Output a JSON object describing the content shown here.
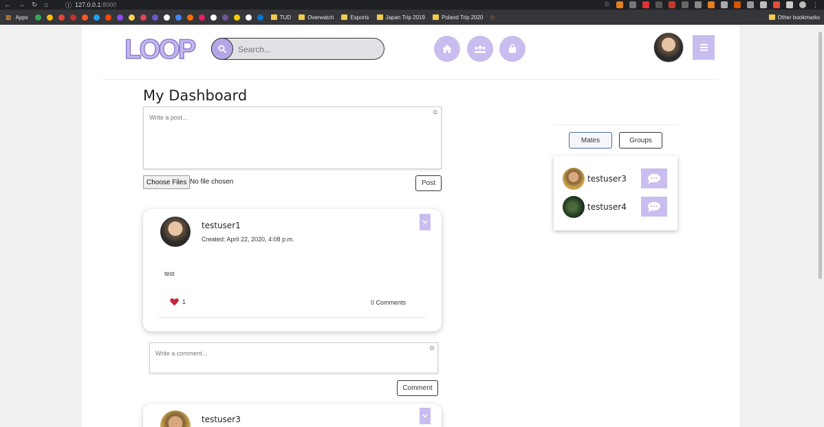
{
  "browser": {
    "url": "127.0.0.1",
    "port": ":8000",
    "bookmarks": {
      "apps": "Apps",
      "folders": [
        "TUD",
        "Overwatch",
        "Esports",
        "Japan Trip 2019",
        "Poland Trip 2020"
      ],
      "other": "Other bookmarks"
    },
    "bookmark_icon_colors": [
      "#34a853",
      "#fbbc04",
      "#ea4335",
      "#c4302b",
      "#ff5722",
      "#1da1f2",
      "#ff4500",
      "#9146ff",
      "#ffd54f",
      "#e94057",
      "#6a5acd",
      "#fff",
      "#4285f4",
      "#ff6f00",
      "#e91e63",
      "#fff",
      "#6e5494",
      "#ffcc00",
      "#fff",
      "#0078d4"
    ]
  },
  "app": {
    "logo": "LOOP",
    "search_placeholder": "Search...",
    "page_title": "My Dashboard",
    "post_placeholder": "Write a post...",
    "choose_files_label": "Choose Files",
    "file_status": "No file chosen",
    "post_button": "Post",
    "comment_placeholder": "Write a comment...",
    "comment_button": "Comment",
    "accent_color": "#c9bdf0"
  },
  "posts": [
    {
      "username": "testuser1",
      "created": "Created: April 22, 2020, 4:08 p.m.",
      "text": "test",
      "likes": "1",
      "comments": "0 Comments"
    },
    {
      "username": "testuser3"
    }
  ],
  "sidebar": {
    "tabs": [
      "Mates",
      "Groups"
    ],
    "mates": [
      {
        "name": "testuser3"
      },
      {
        "name": "testuser4"
      }
    ]
  }
}
